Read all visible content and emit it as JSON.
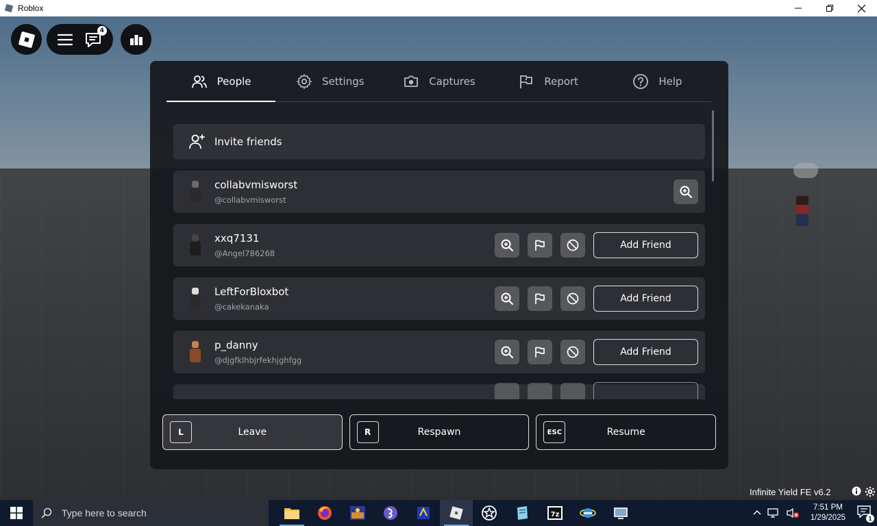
{
  "window": {
    "title": "Roblox"
  },
  "topbar": {
    "chat_badge": "4"
  },
  "tabs": [
    {
      "label": "People",
      "icon": "people-icon",
      "active": true
    },
    {
      "label": "Settings",
      "icon": "gear-icon",
      "active": false
    },
    {
      "label": "Captures",
      "icon": "camera-icon",
      "active": false
    },
    {
      "label": "Report",
      "icon": "flag-icon",
      "active": false
    },
    {
      "label": "Help",
      "icon": "help-icon",
      "active": false
    }
  ],
  "invite": {
    "label": "Invite friends"
  },
  "players": [
    {
      "display_name": "collabvmisworst",
      "username": "@collabvmisworst",
      "is_self": true
    },
    {
      "display_name": "xxq7131",
      "username": "@Angel786268",
      "add_label": "Add Friend"
    },
    {
      "display_name": "LeftForBloxbot",
      "username": "@cakekanaka",
      "add_label": "Add Friend"
    },
    {
      "display_name": "p_danny",
      "username": "@djgfklhbjrfekhjghfgg",
      "add_label": "Add Friend"
    }
  ],
  "bottom_buttons": [
    {
      "key": "L",
      "label": "Leave"
    },
    {
      "key": "R",
      "label": "Respawn"
    },
    {
      "key": "ESC",
      "label": "Resume"
    }
  ],
  "overlay": {
    "infinite_yield": "Infinite Yield FE v6.2"
  },
  "taskbar": {
    "search_placeholder": "Type here to search",
    "time": "7:51 PM",
    "date": "1/29/2025",
    "notification_count": "1"
  },
  "colors": {
    "panel": "#16181c",
    "accent": "#ffffff",
    "taskbar": "#0f1a2e"
  }
}
